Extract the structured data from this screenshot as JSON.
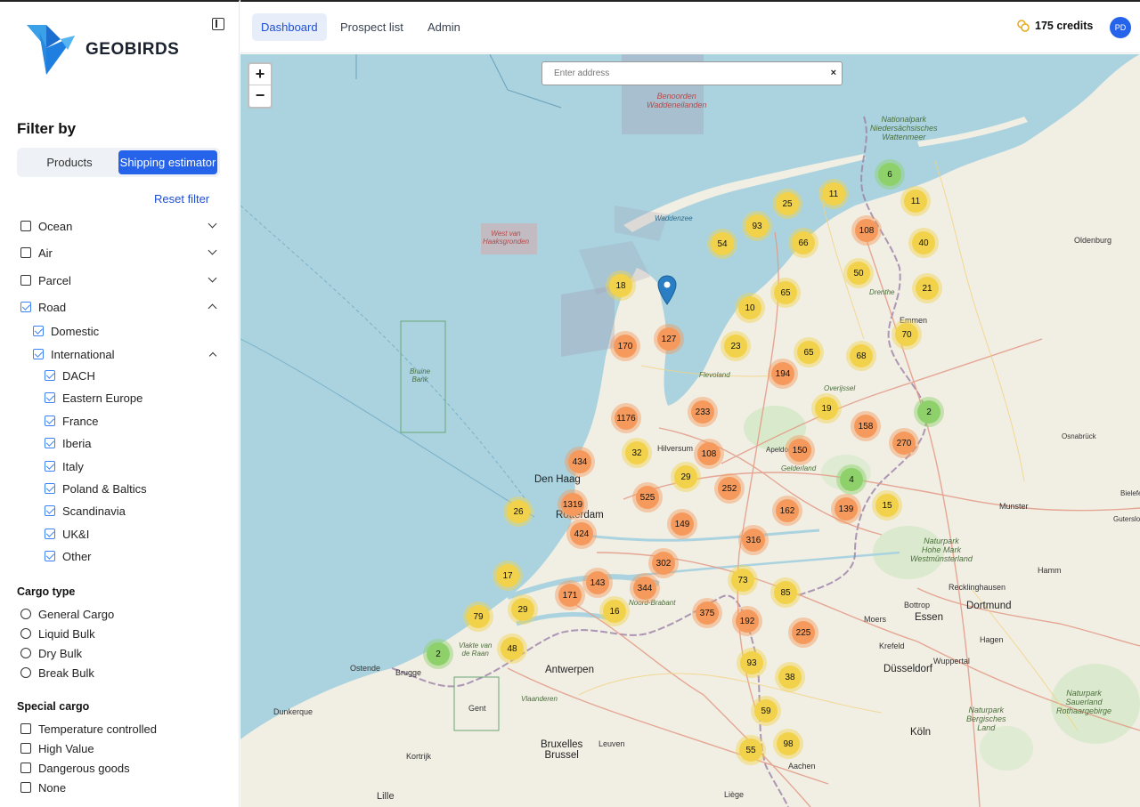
{
  "brand": {
    "name": "GEOBIRDS"
  },
  "nav": {
    "dashboard": "Dashboard",
    "prospect_list": "Prospect list",
    "admin": "Admin"
  },
  "account": {
    "credits": "175 credits",
    "avatar_initials": "PD"
  },
  "sidebar": {
    "filter_title": "Filter by",
    "tabs": {
      "products": "Products",
      "shipping": "Shipping estimator"
    },
    "reset": "Reset filter",
    "modes": {
      "ocean": "Ocean",
      "air": "Air",
      "parcel": "Parcel",
      "road": "Road"
    },
    "road": {
      "domestic": "Domestic",
      "international": "International"
    },
    "regions": [
      "DACH",
      "Eastern Europe",
      "France",
      "Iberia",
      "Italy",
      "Poland & Baltics",
      "Scandinavia",
      "UK&I",
      "Other"
    ],
    "cargo_type": {
      "title": "Cargo type",
      "options": [
        "General Cargo",
        "Liquid Bulk",
        "Dry Bulk",
        "Break Bulk"
      ]
    },
    "special_cargo": {
      "title": "Special cargo",
      "options": [
        "Temperature controlled",
        "High Value",
        "Dangerous goods",
        "None"
      ]
    }
  },
  "map": {
    "search_placeholder": "Enter address",
    "zoom_in": "+",
    "zoom_out": "−",
    "clusters": [
      {
        "v": "6",
        "c": "green"
      },
      {
        "v": "11",
        "c": "yellow"
      },
      {
        "v": "11",
        "c": "yellow"
      },
      {
        "v": "25",
        "c": "yellow"
      },
      {
        "v": "93",
        "c": "yellow"
      },
      {
        "v": "108",
        "c": "orange"
      },
      {
        "v": "54",
        "c": "yellow"
      },
      {
        "v": "66",
        "c": "yellow"
      },
      {
        "v": "40",
        "c": "yellow"
      },
      {
        "v": "50",
        "c": "yellow"
      },
      {
        "v": "18",
        "c": "yellow"
      },
      {
        "v": "65",
        "c": "yellow"
      },
      {
        "v": "21",
        "c": "yellow"
      },
      {
        "v": "10",
        "c": "yellow"
      },
      {
        "v": "170",
        "c": "orange"
      },
      {
        "v": "127",
        "c": "orange"
      },
      {
        "v": "23",
        "c": "yellow"
      },
      {
        "v": "70",
        "c": "yellow"
      },
      {
        "v": "65",
        "c": "yellow"
      },
      {
        "v": "68",
        "c": "yellow"
      },
      {
        "v": "194",
        "c": "orange"
      },
      {
        "v": "1176",
        "c": "orange"
      },
      {
        "v": "233",
        "c": "orange"
      },
      {
        "v": "19",
        "c": "yellow"
      },
      {
        "v": "158",
        "c": "orange"
      },
      {
        "v": "2",
        "c": "green"
      },
      {
        "v": "270",
        "c": "orange"
      },
      {
        "v": "32",
        "c": "yellow"
      },
      {
        "v": "108",
        "c": "orange"
      },
      {
        "v": "434",
        "c": "orange"
      },
      {
        "v": "150",
        "c": "orange"
      },
      {
        "v": "29",
        "c": "yellow"
      },
      {
        "v": "252",
        "c": "orange"
      },
      {
        "v": "4",
        "c": "green"
      },
      {
        "v": "525",
        "c": "orange"
      },
      {
        "v": "1319",
        "c": "orange"
      },
      {
        "v": "26",
        "c": "yellow"
      },
      {
        "v": "162",
        "c": "orange"
      },
      {
        "v": "139",
        "c": "orange"
      },
      {
        "v": "15",
        "c": "yellow"
      },
      {
        "v": "424",
        "c": "orange"
      },
      {
        "v": "149",
        "c": "orange"
      },
      {
        "v": "316",
        "c": "orange"
      },
      {
        "v": "302",
        "c": "orange"
      },
      {
        "v": "17",
        "c": "yellow"
      },
      {
        "v": "143",
        "c": "orange"
      },
      {
        "v": "171",
        "c": "orange"
      },
      {
        "v": "344",
        "c": "orange"
      },
      {
        "v": "73",
        "c": "yellow"
      },
      {
        "v": "85",
        "c": "yellow"
      },
      {
        "v": "29",
        "c": "yellow"
      },
      {
        "v": "79",
        "c": "yellow"
      },
      {
        "v": "16",
        "c": "yellow"
      },
      {
        "v": "375",
        "c": "orange"
      },
      {
        "v": "192",
        "c": "orange"
      },
      {
        "v": "225",
        "c": "orange"
      },
      {
        "v": "2",
        "c": "green"
      },
      {
        "v": "48",
        "c": "yellow"
      },
      {
        "v": "93",
        "c": "yellow"
      },
      {
        "v": "38",
        "c": "yellow"
      },
      {
        "v": "59",
        "c": "yellow"
      },
      {
        "v": "98",
        "c": "yellow"
      },
      {
        "v": "55",
        "c": "yellow"
      }
    ],
    "places": [
      "Den Haag",
      "Rotterdam",
      "Antwerpen",
      "Düsseldorf",
      "Dortmund",
      "Essen",
      "Köln",
      "Bruxelles\nBrussel",
      "Oldenburg",
      "Emmen",
      "Drenthe",
      "Munster",
      "Hamm",
      "Krefeld",
      "Hagen",
      "Liège",
      "Gent",
      "Brugge",
      "Leuven",
      "Kortrijk",
      "Lille",
      "Dunkerque",
      "Ostende",
      "Aachen",
      "Wuppertal",
      "Bottrop",
      "Recklinghausen",
      "Moers",
      "Hilversum",
      "Noord-Brabant",
      "Gelderland",
      "Flevoland",
      "Overijssel",
      "Waddenzee",
      "Vlaanderen",
      "Apeldoorn",
      "Bielefeld",
      "Gutersloh",
      "Osnabrück"
    ],
    "regions": [
      "Benoorden\nWaddeneilanden",
      "Nationalpark\nNiedersächsisches\nWattenmeer",
      "Naturpark\nHohe Mark\nWestmünsterland",
      "Naturpark\nBergisches\nLand",
      "Naturpark\nSauerland\nRothaargebirge",
      "West van\nHaaksgronden",
      "Bruine\nBank",
      "Vlakte van\nde Raan"
    ],
    "colors": {
      "green": "#8ed16b",
      "yellow": "#f2d24b",
      "orange": "#f59a5c",
      "accent": "#2563eb"
    }
  }
}
